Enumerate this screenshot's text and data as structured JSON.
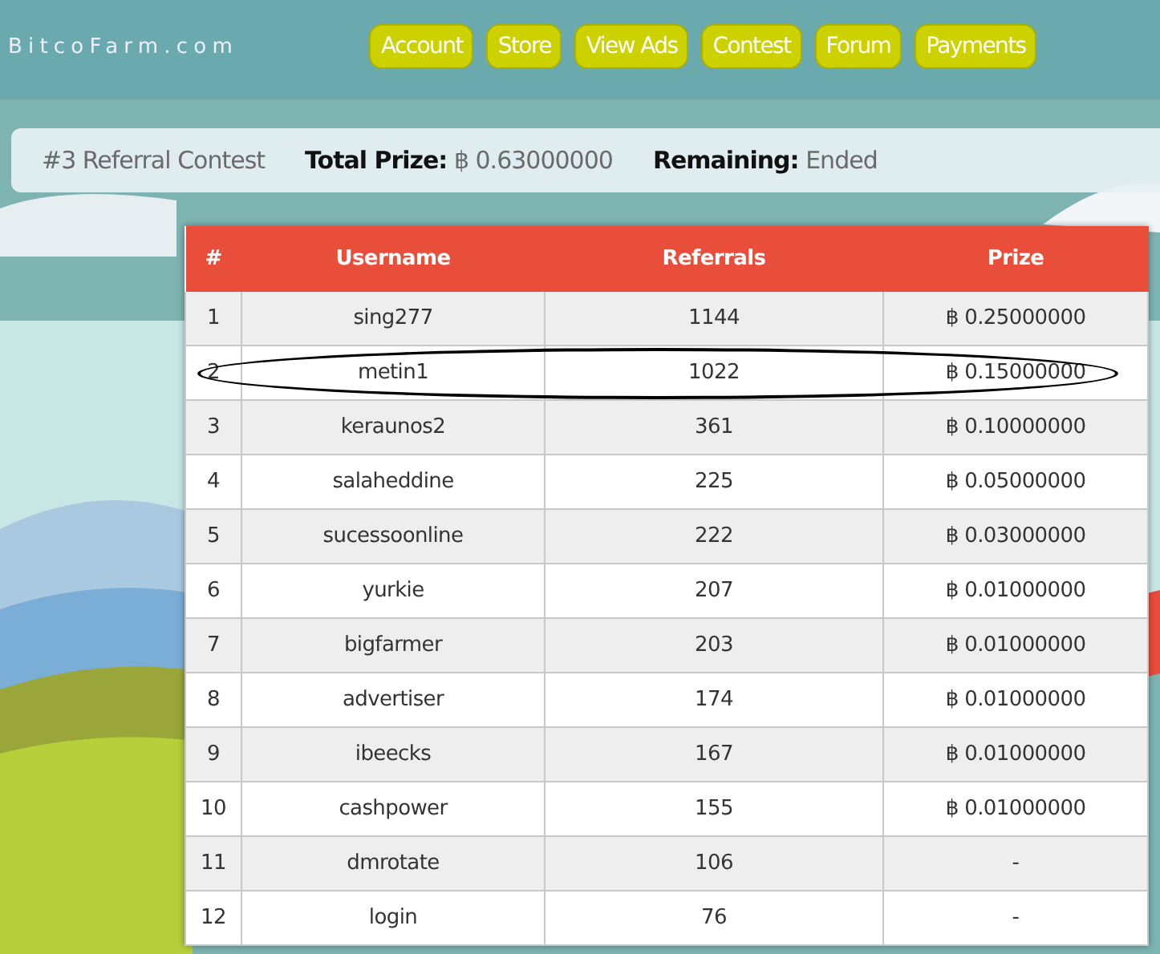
{
  "header": {
    "logo": "BitcoFarm.com",
    "nav": [
      {
        "label": "Account"
      },
      {
        "label": "Store"
      },
      {
        "label": "View Ads"
      },
      {
        "label": "Contest"
      },
      {
        "label": "Forum"
      },
      {
        "label": "Payments"
      }
    ]
  },
  "contest_bar": {
    "title": "#3 Referral Contest",
    "total_prize_label": "Total Prize:",
    "total_prize": "฿ 0.63000000",
    "remaining_label": "Remaining:",
    "remaining": "Ended"
  },
  "table": {
    "columns": [
      "#",
      "Username",
      "Referrals",
      "Prize"
    ],
    "rows": [
      {
        "cells": [
          "1",
          "sing277",
          "1144",
          "฿ 0.25000000"
        ],
        "circled": false
      },
      {
        "cells": [
          "2",
          "metin1",
          "1022",
          "฿ 0.15000000"
        ],
        "circled": true
      },
      {
        "cells": [
          "3",
          "keraunos2",
          "361",
          "฿ 0.10000000"
        ],
        "circled": false
      },
      {
        "cells": [
          "4",
          "salaheddine",
          "225",
          "฿ 0.05000000"
        ],
        "circled": false
      },
      {
        "cells": [
          "5",
          "sucessoonline",
          "222",
          "฿ 0.03000000"
        ],
        "circled": false
      },
      {
        "cells": [
          "6",
          "yurkie",
          "207",
          "฿ 0.01000000"
        ],
        "circled": false
      },
      {
        "cells": [
          "7",
          "bigfarmer",
          "203",
          "฿ 0.01000000"
        ],
        "circled": false
      },
      {
        "cells": [
          "8",
          "advertiser",
          "174",
          "฿ 0.01000000"
        ],
        "circled": false
      },
      {
        "cells": [
          "9",
          "ibeecks",
          "167",
          "฿ 0.01000000"
        ],
        "circled": false
      },
      {
        "cells": [
          "10",
          "cashpower",
          "155",
          "฿ 0.01000000"
        ],
        "circled": false
      },
      {
        "cells": [
          "11",
          "dmrotate",
          "106",
          "-"
        ],
        "circled": false
      },
      {
        "cells": [
          "12",
          "login",
          "76",
          "-"
        ],
        "circled": false
      }
    ]
  }
}
